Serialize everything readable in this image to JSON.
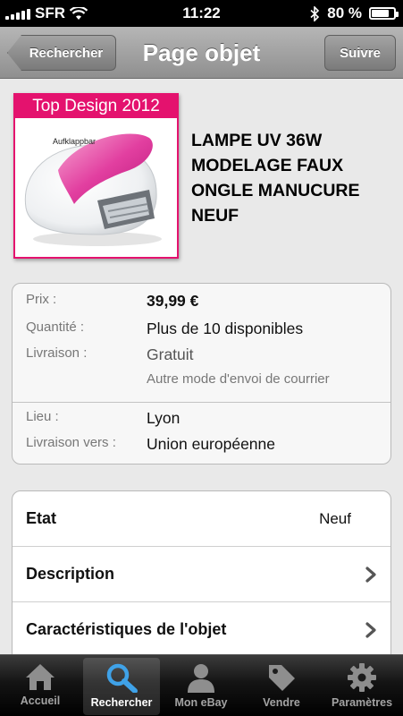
{
  "status_bar": {
    "carrier": "SFR",
    "time": "11:22",
    "battery": "80 %",
    "battery_level": 0.8
  },
  "nav": {
    "back_label": "Rechercher",
    "title": "Page objet",
    "next_label": "Suivre"
  },
  "item": {
    "image_banner": "Top Design 2012",
    "image_caption": "Aufklappbar",
    "title": "LAMPE UV 36W MODELAGE FAUX ONGLE MANUCURE NEUF"
  },
  "details": {
    "price_label": "Prix :",
    "price_value": "39,99 €",
    "quantity_label": "Quantité :",
    "quantity_value": "Plus de 10 disponibles",
    "shipping_label": "Livraison :",
    "shipping_value": "Gratuit",
    "shipping_note": "Autre mode d'envoi de courrier",
    "location_label": "Lieu :",
    "location_value": "Lyon",
    "ships_to_label": "Livraison vers :",
    "ships_to_value": "Union européenne"
  },
  "table": {
    "condition_label": "Etat",
    "condition_value": "Neuf",
    "description_label": "Description",
    "specifics_label": "Caractéristiques de l'objet"
  },
  "tabs": [
    {
      "label": "Accueil",
      "icon": "home-icon",
      "active": false
    },
    {
      "label": "Rechercher",
      "icon": "search-icon",
      "active": true
    },
    {
      "label": "Mon eBay",
      "icon": "person-icon",
      "active": false
    },
    {
      "label": "Vendre",
      "icon": "tag-icon",
      "active": false
    },
    {
      "label": "Paramètres",
      "icon": "gear-icon",
      "active": false
    }
  ],
  "colors": {
    "banner_pink": "#e4126e",
    "active_tab_blue": "#3fa2e8"
  }
}
